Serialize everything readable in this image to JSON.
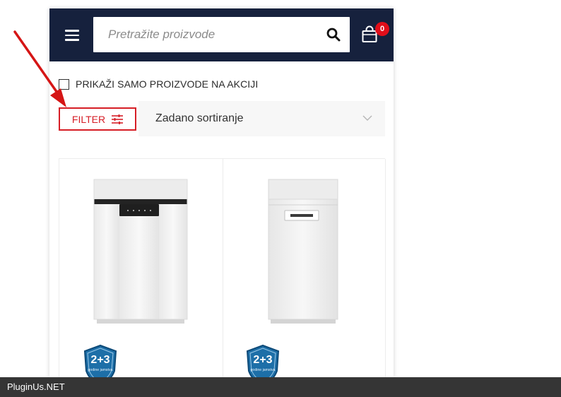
{
  "header": {
    "search_placeholder": "Pretražite proizvode",
    "cart_count": "0"
  },
  "promo_filter": {
    "label": "PRIKAŽI SAMO PROIZVODE NA AKCIJI",
    "checked": false
  },
  "filter_button": {
    "label": "FILTER"
  },
  "sort_select": {
    "selected": "Zadano sortiranje"
  },
  "products": [
    {
      "image": "freestanding-dishwasher-full-size",
      "warranty_badge": {
        "main": "2+3",
        "sub": "godine jamstva"
      }
    },
    {
      "image": "freestanding-dishwasher-slim",
      "warranty_badge": {
        "main": "2+3",
        "sub": "godine jamstva"
      }
    }
  ],
  "footer_bar": {
    "text": "PluginUs.NET"
  },
  "colors": {
    "header_bg": "#16213d",
    "accent_red": "#d61e26",
    "badge_red": "#e10e1a",
    "footer_bar_bg": "#353535"
  },
  "annotation": {
    "type": "red-arrow",
    "points_to": "filter-button"
  }
}
